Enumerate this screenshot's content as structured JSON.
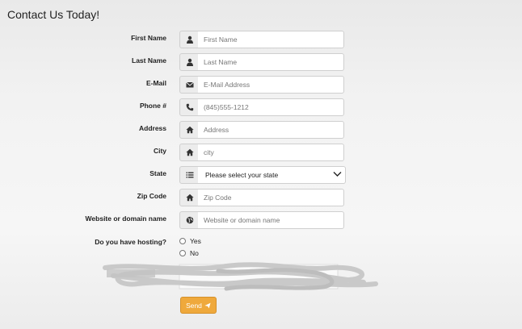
{
  "page": {
    "title": "Contact Us Today!"
  },
  "form": {
    "fields": [
      {
        "label": "First Name",
        "placeholder": "First Name",
        "value": "",
        "icon": "user-icon"
      },
      {
        "label": "Last Name",
        "placeholder": "Last Name",
        "value": "",
        "icon": "user-icon"
      },
      {
        "label": "E-Mail",
        "placeholder": "E-Mail Address",
        "value": "",
        "icon": "envelope-icon"
      },
      {
        "label": "Phone #",
        "placeholder": "(845)555-1212",
        "value": "",
        "icon": "phone-icon"
      },
      {
        "label": "Address",
        "placeholder": "Address",
        "value": "",
        "icon": "home-icon"
      },
      {
        "label": "City",
        "placeholder": "city",
        "value": "",
        "icon": "home-icon"
      },
      {
        "label": "State",
        "selected": "Please select your state",
        "icon": "list-icon"
      },
      {
        "label": "Zip Code",
        "placeholder": "Zip Code",
        "value": "",
        "icon": "home-icon"
      },
      {
        "label": "Website or domain name",
        "placeholder": "Website or domain name",
        "value": "",
        "icon": "globe-icon"
      }
    ],
    "hosting": {
      "label": "Do you have hosting?",
      "options": [
        "Yes",
        "No"
      ]
    },
    "send_label": "Send",
    "send_color": "#efa93c"
  }
}
